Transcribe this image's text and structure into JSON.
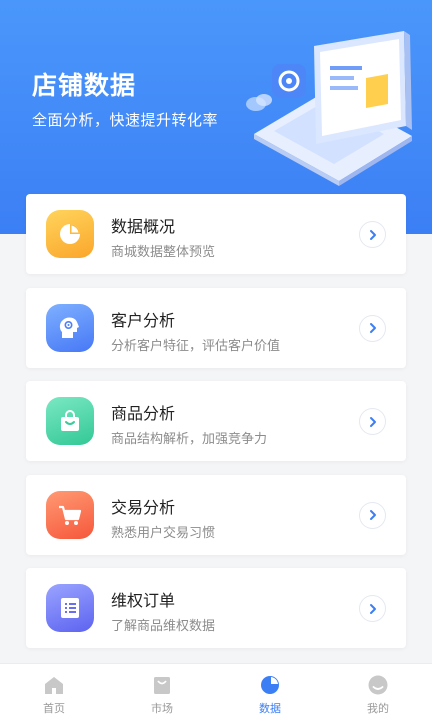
{
  "header": {
    "title": "店铺数据",
    "subtitle": "全面分析，快速提升转化率"
  },
  "cards": [
    {
      "title": "数据概况",
      "desc": "商城数据整体预览",
      "icon": "pie-chart-icon",
      "colors": [
        "#ffd45c",
        "#fba62b"
      ]
    },
    {
      "title": "客户分析",
      "desc": "分析客户特征，评估客户价值",
      "icon": "customer-head-icon",
      "colors": [
        "#7eb0ff",
        "#4778f6"
      ]
    },
    {
      "title": "商品分析",
      "desc": "商品结构解析，加强竞争力",
      "icon": "shopping-bag-icon",
      "colors": [
        "#7ae8c3",
        "#33c895"
      ]
    },
    {
      "title": "交易分析",
      "desc": "熟悉用户交易习惯",
      "icon": "shopping-cart-icon",
      "colors": [
        "#ff9a73",
        "#f6573b"
      ]
    },
    {
      "title": "维权订单",
      "desc": "了解商品维权数据",
      "icon": "document-icon",
      "colors": [
        "#9aa4ff",
        "#5d63f0"
      ]
    }
  ],
  "tabs": [
    {
      "label": "首页",
      "icon": "home-icon",
      "active": false
    },
    {
      "label": "市场",
      "icon": "bag-icon",
      "active": false
    },
    {
      "label": "数据",
      "icon": "pie-chart-icon",
      "active": true
    },
    {
      "label": "我的",
      "icon": "user-face-icon",
      "active": false
    }
  ],
  "colors": {
    "accent": "#3c7ff5",
    "hero_top": "#4a97fb",
    "hero_bottom": "#3c7ff5",
    "inactive": "#c8c8c8"
  }
}
